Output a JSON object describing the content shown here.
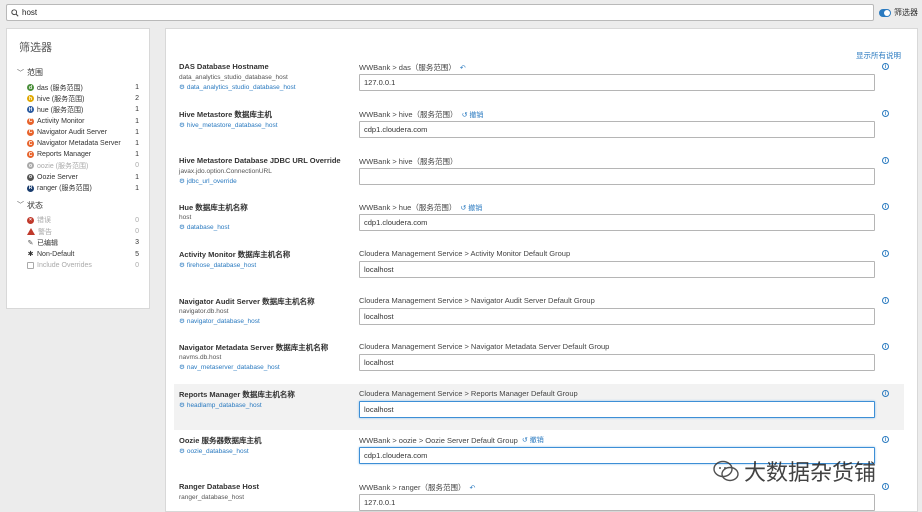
{
  "search": {
    "value": "host"
  },
  "filter_toggle": {
    "label": "筛选器",
    "on": true
  },
  "sidebar": {
    "title": "筛选器",
    "scope_label": "范围",
    "scope_items": [
      {
        "label": "das (服务范围)",
        "count": "1",
        "icon": "das-icon",
        "color": "#4a8f3a",
        "dim": false
      },
      {
        "label": "hive (服务范围)",
        "count": "2",
        "icon": "hive-icon",
        "color": "#e0a800",
        "dim": false
      },
      {
        "label": "hue (服务范围)",
        "count": "1",
        "icon": "hue-icon",
        "color": "#2a5aa0",
        "dim": false
      },
      {
        "label": "Activity Monitor",
        "count": "1",
        "icon": "cloudera-icon",
        "color": "#e8632b",
        "dim": false
      },
      {
        "label": "Navigator Audit Server",
        "count": "1",
        "icon": "cloudera-icon",
        "color": "#e8632b",
        "dim": false
      },
      {
        "label": "Navigator Metadata Server",
        "count": "1",
        "icon": "cloudera-icon",
        "color": "#e8632b",
        "dim": false
      },
      {
        "label": "Reports Manager",
        "count": "1",
        "icon": "cloudera-icon",
        "color": "#e8632b",
        "dim": false
      },
      {
        "label": "oozie (服务范围)",
        "count": "0",
        "icon": "oozie-icon",
        "color": "#aaaaaa",
        "dim": true
      },
      {
        "label": "Oozie Server",
        "count": "1",
        "icon": "oozie-icon",
        "color": "#555555",
        "dim": false
      },
      {
        "label": "ranger (服务范围)",
        "count": "1",
        "icon": "ranger-icon",
        "color": "#1a3d6e",
        "dim": false
      }
    ],
    "status_label": "状态",
    "status_items": [
      {
        "label": "错误",
        "count": "0",
        "icon": "error-icon",
        "color": "#c0392b",
        "dim": true
      },
      {
        "label": "警告",
        "count": "0",
        "icon": "warning-icon",
        "color": "#c0392b",
        "dim": true
      },
      {
        "label": "已编辑",
        "count": "3",
        "icon": "edit-icon",
        "color": "#555555",
        "dim": false
      },
      {
        "label": "Non-Default",
        "count": "5",
        "icon": "gear-icon",
        "color": "#333333",
        "dim": false
      },
      {
        "label": "Include Overrides",
        "count": "0",
        "icon": "checkbox-icon",
        "color": "#aaaaaa",
        "dim": true
      }
    ]
  },
  "main": {
    "show_all_desc": "显示所有说明",
    "rows": [
      {
        "title": "DAS Database Hostname",
        "prop": "data_analytics_studio_database_host",
        "link": "data_analytics_studio_database_host",
        "scope": "WWBank > das（服务范围）",
        "undo": "",
        "undo_icon": true,
        "value": "127.0.0.1"
      },
      {
        "title": "Hive Metastore 数据库主机",
        "prop": "",
        "link": "hive_metastore_database_host",
        "scope": "WWBank > hive（服务范围）",
        "undo": "撤销",
        "undo_icon": true,
        "value": "cdp1.cloudera.com"
      },
      {
        "title": "Hive Metastore Database JDBC URL Override",
        "prop": "javax.jdo.option.ConnectionURL",
        "link": "jdbc_url_override",
        "scope": "WWBank > hive（服务范围）",
        "undo": "",
        "undo_icon": false,
        "value": ""
      },
      {
        "title": "Hue 数据库主机名称",
        "prop": "host",
        "link": "database_host",
        "scope": "WWBank > hue（服务范围）",
        "undo": "撤销",
        "undo_icon": true,
        "value": "cdp1.cloudera.com"
      },
      {
        "title": "Activity Monitor 数据库主机名称",
        "prop": "",
        "link": "firehose_database_host",
        "scope": "Cloudera Management Service > Activity Monitor Default Group",
        "undo": "",
        "undo_icon": false,
        "value": "localhost"
      },
      {
        "title": "Navigator Audit Server 数据库主机名称",
        "prop": "navigator.db.host",
        "link": "navigator_database_host",
        "scope": "Cloudera Management Service > Navigator Audit Server Default Group",
        "undo": "",
        "undo_icon": false,
        "value": "localhost"
      },
      {
        "title": "Navigator Metadata Server 数据库主机名称",
        "prop": "navms.db.host",
        "link": "nav_metaserver_database_host",
        "scope": "Cloudera Management Service > Navigator Metadata Server Default Group",
        "undo": "",
        "undo_icon": false,
        "value": "localhost"
      },
      {
        "title": "Reports Manager 数据库主机名称",
        "prop": "",
        "link": "headlamp_database_host",
        "scope": "Cloudera Management Service > Reports Manager Default Group",
        "undo": "",
        "undo_icon": false,
        "value": "localhost"
      },
      {
        "title": "Oozie 服务器数据库主机",
        "prop": "",
        "link": "oozie_database_host",
        "scope": "WWBank > oozie > Oozie Server Default Group",
        "undo": "撤销",
        "undo_icon": true,
        "value": "cdp1.cloudera.com"
      },
      {
        "title": "Ranger Database Host",
        "prop": "ranger_database_host",
        "link": "",
        "scope": "WWBank > ranger（服务范围）",
        "undo": "",
        "undo_icon": true,
        "value": "127.0.0.1"
      }
    ]
  },
  "watermark": {
    "text": "大数据杂货铺"
  },
  "colors": {
    "accent": "#2a7ac0",
    "highlight_row": "#f2f2f2"
  }
}
